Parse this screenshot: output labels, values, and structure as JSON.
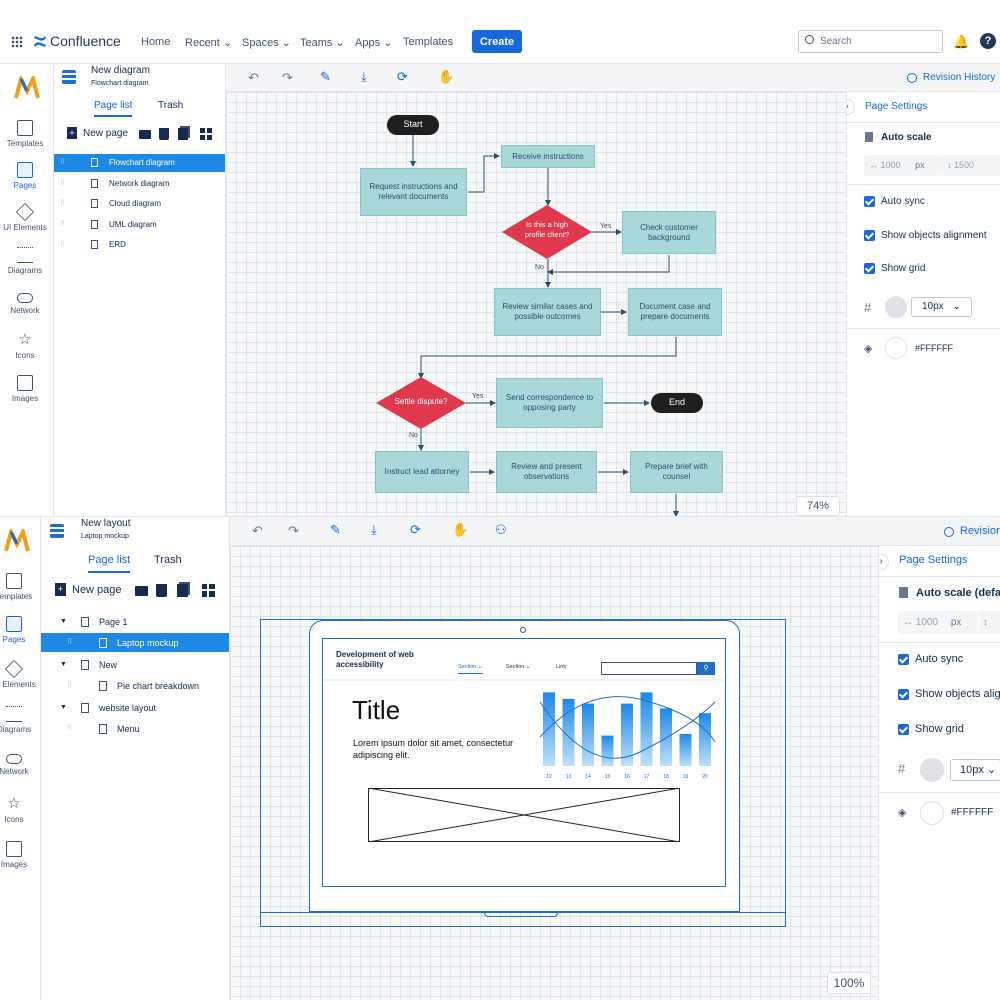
{
  "topbar": {
    "app_name": "Confluence",
    "nav": [
      "Home",
      "Recent",
      "Spaces",
      "Teams",
      "Apps",
      "Templates"
    ],
    "create": "Create",
    "search_placeholder": "Search"
  },
  "rail": {
    "items": [
      "Templates",
      "Pages",
      "UI Elements",
      "Diagrams",
      "Network",
      "Icons",
      "Images"
    ]
  },
  "top": {
    "doc_title": "New diagram",
    "doc_subtitle": "Flowchart diagram",
    "tabs": [
      "Page list",
      "Trash"
    ],
    "new_page": "New page",
    "pages": [
      "Flowchart diagram",
      "Network diagram",
      "Cloud diagram",
      "UML diagram",
      "ERD"
    ],
    "revision": "Revision History",
    "zoom": "74%",
    "settings": {
      "title": "Page Settings",
      "auto_scale": "Auto scale",
      "width": "1000",
      "height": "1500",
      "unit": "px",
      "auto_sync": "Auto sync",
      "show_align": "Show objects alignment",
      "show_grid": "Show grid",
      "grid_size": "10px",
      "bg_color": "#FFFFFF"
    }
  },
  "flow": {
    "start": "Start",
    "end": "End",
    "request": "Request instructions and relevant documents",
    "receive": "Receive instructions",
    "decision1": "Is this a high profile client?",
    "yes": "Yes",
    "no": "No",
    "check": "Check customer background",
    "review": "Review similar cases and possible outcomes",
    "document": "Document case and prepare documents",
    "decision2": "Settle dispute?",
    "send": "Send correspondence to opposing party",
    "instruct": "Instruct lead attorney",
    "review_present": "Review and present observations",
    "brief": "Prepare brief with counsel"
  },
  "bottom": {
    "doc_title": "New layout",
    "doc_subtitle": "Laptop mockup",
    "tabs": [
      "Page list",
      "Trash"
    ],
    "new_page": "New page",
    "tree": [
      "Page 1",
      "Laptop mockup",
      "New",
      "Pie chart breakdown",
      "website layout",
      "Menu"
    ],
    "revision": "Revision",
    "zoom": "100%",
    "settings": {
      "title": "Page Settings",
      "auto_scale": "Auto scale (defa",
      "width": "1000",
      "unit": "px",
      "auto_sync": "Auto sync",
      "show_align": "Show objects alig",
      "show_grid": "Show grid",
      "grid_size": "10px",
      "bg_color": "#FFFFFF"
    }
  },
  "mockup": {
    "site_title": "Development of web accessibility",
    "nav": [
      "Section",
      "Section",
      "Link"
    ],
    "title": "Title",
    "body": "Lorem ipsum dolor sit amet, consectetur adipiscing elit."
  },
  "chart_data": {
    "type": "bar",
    "categories": [
      "12",
      "13",
      "14",
      "15",
      "16",
      "17",
      "18",
      "19",
      "20"
    ],
    "values": [
      92,
      84,
      78,
      38,
      78,
      92,
      72,
      40,
      66
    ]
  },
  "colors": {
    "accent": "#1868db",
    "decision": "#e0394d",
    "process": "#a9d8da",
    "selected": "#1e88e5"
  }
}
